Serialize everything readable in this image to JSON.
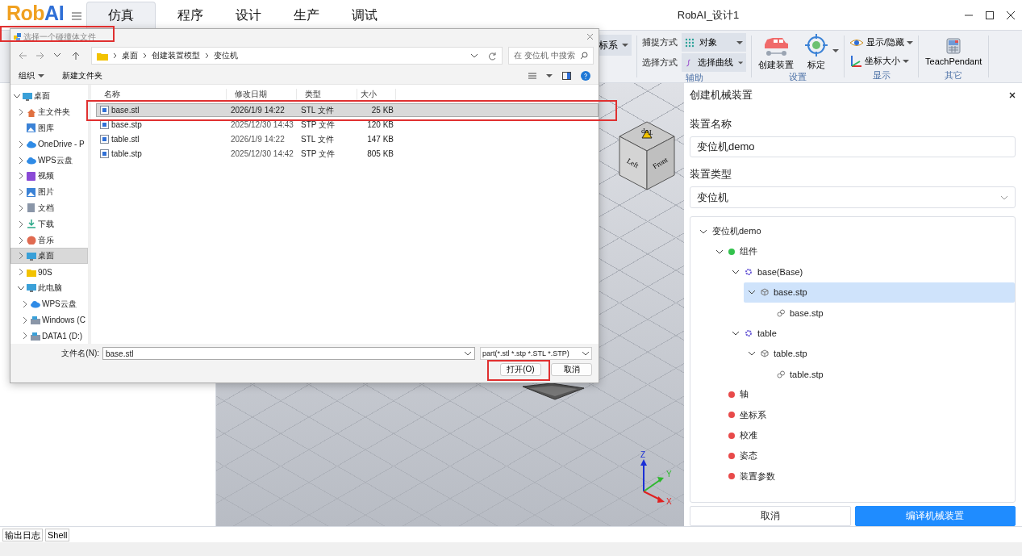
{
  "app": {
    "logo": [
      {
        "text": "Rob",
        "color": "#f0a020"
      },
      {
        "text": "AI",
        "color": "#2f6fd6"
      }
    ],
    "tabs": [
      {
        "label": "仿真",
        "selected": true
      },
      {
        "label": "程序",
        "selected": false
      },
      {
        "label": "设计",
        "selected": false
      },
      {
        "label": "生产",
        "selected": false
      },
      {
        "label": "调试",
        "selected": false
      }
    ],
    "window_title": "RobAI_设计1"
  },
  "ribbon": {
    "partial_control": {
      "label": "标系",
      "dropdown": true
    },
    "groups": [
      {
        "label": "辅助",
        "kind": "dropdowns",
        "items": [
          {
            "label": "捕捉方式",
            "value": "对象"
          },
          {
            "label": "选择方式",
            "value": "选择曲线"
          }
        ]
      },
      {
        "label": "设置",
        "kind": "large",
        "items": [
          {
            "label": "创建装置",
            "dropdown": false
          },
          {
            "label": "标定",
            "dropdown": true
          }
        ]
      },
      {
        "label": "显示",
        "kind": "small",
        "items": [
          {
            "label": "显示/隐藏",
            "dropdown": true
          },
          {
            "label": "坐标大小",
            "dropdown": true
          }
        ]
      },
      {
        "label": "其它",
        "kind": "large",
        "items": [
          {
            "label": "TeachPendant",
            "dropdown": false
          }
        ]
      }
    ]
  },
  "viewport": {
    "view_cube": [
      "Top",
      "Left",
      "Front"
    ],
    "axes": [
      "Z",
      "Y",
      "X"
    ]
  },
  "right_panel": {
    "title": "创建机械装置",
    "fields": [
      {
        "label": "装置名称",
        "kind": "text",
        "value": "变位机demo"
      },
      {
        "label": "装置类型",
        "kind": "select",
        "value": "变位机"
      }
    ],
    "tree": [
      {
        "label": "变位机demo",
        "expanded": true,
        "selected": false,
        "children": [
          {
            "label": "组件",
            "kind": "group",
            "color": "#33c24d",
            "expanded": true,
            "selected": false,
            "children": [
              {
                "label": "base(Base)",
                "kind": "assembly",
                "expanded": true,
                "selected": false,
                "children": [
                  {
                    "label": "base.stp",
                    "kind": "part",
                    "expanded": true,
                    "selected": true,
                    "children": [
                      {
                        "label": "base.stp",
                        "kind": "file",
                        "selected": false
                      }
                    ]
                  }
                ]
              },
              {
                "label": "table",
                "kind": "assembly",
                "expanded": true,
                "selected": false,
                "children": [
                  {
                    "label": "table.stp",
                    "kind": "part",
                    "expanded": true,
                    "selected": false,
                    "children": [
                      {
                        "label": "table.stp",
                        "kind": "file",
                        "selected": false
                      }
                    ]
                  }
                ]
              }
            ]
          },
          {
            "label": "轴",
            "kind": "group",
            "color": "#e84a4a",
            "selected": false
          },
          {
            "label": "坐标系",
            "kind": "group",
            "color": "#e84a4a",
            "selected": false
          },
          {
            "label": "校准",
            "kind": "group",
            "color": "#e84a4a",
            "selected": false
          },
          {
            "label": "姿态",
            "kind": "group",
            "color": "#e84a4a",
            "selected": false
          },
          {
            "label": "装置参数",
            "kind": "group",
            "color": "#e84a4a",
            "selected": false
          }
        ]
      }
    ],
    "buttons": [
      {
        "label": "取消",
        "kind": "secondary"
      },
      {
        "label": "编译机械装置",
        "kind": "primary"
      }
    ]
  },
  "bottom_tabs": [
    "输出日志",
    "Shell"
  ],
  "dialog": {
    "title": "选择一个碰撞体文件",
    "title_highlighted": true,
    "breadcrumb": [
      "桌面",
      "创建装置模型",
      "变位机"
    ],
    "search": {
      "placeholder": "在 变位机 中搜索"
    },
    "toolbar": [
      {
        "label": "组织",
        "dropdown": true
      },
      {
        "label": "新建文件夹",
        "dropdown": false
      }
    ],
    "nav": [
      {
        "label": "桌面",
        "expanded": true,
        "selected": false,
        "children": [
          {
            "label": "主文件夹",
            "expanded": false,
            "selected": false
          },
          {
            "label": "图库",
            "selected": false
          },
          {
            "label": "OneDrive - P",
            "expanded": false,
            "selected": false
          },
          {
            "label": "WPS云盘",
            "expanded": false,
            "selected": false
          },
          {
            "label": "视频",
            "expanded": false,
            "selected": false
          },
          {
            "label": "图片",
            "expanded": false,
            "selected": false
          },
          {
            "label": "文档",
            "expanded": false,
            "selected": false
          },
          {
            "label": "下载",
            "expanded": false,
            "selected": false
          },
          {
            "label": "音乐",
            "expanded": false,
            "selected": false
          },
          {
            "label": "桌面",
            "expanded": false,
            "selected": true
          },
          {
            "label": "90S",
            "expanded": false,
            "selected": false
          },
          {
            "label": "此电脑",
            "expanded": true,
            "selected": false,
            "children": [
              {
                "label": "WPS云盘",
                "expanded": false,
                "selected": false
              },
              {
                "label": "Windows (C",
                "expanded": false,
                "selected": false
              },
              {
                "label": "DATA1 (D:)",
                "expanded": false,
                "selected": false
              }
            ]
          }
        ]
      }
    ],
    "columns": [
      "名称",
      "修改日期",
      "类型",
      "大小"
    ],
    "files": [
      {
        "name": "base.stl",
        "modified": "2026/1/9 14:22",
        "type": "STL 文件",
        "size": "25 KB",
        "selected": true,
        "highlighted": true
      },
      {
        "name": "base.stp",
        "modified": "2025/12/30 14:43",
        "type": "STP 文件",
        "size": "120 KB",
        "selected": false,
        "highlighted": false
      },
      {
        "name": "table.stl",
        "modified": "2026/1/9 14:22",
        "type": "STL 文件",
        "size": "147 KB",
        "selected": false,
        "highlighted": false
      },
      {
        "name": "table.stp",
        "modified": "2025/12/30 14:42",
        "type": "STP 文件",
        "size": "805 KB",
        "selected": false,
        "highlighted": false
      }
    ],
    "file_name_label": "文件名(N):",
    "file_name": "base.stl",
    "file_type": "part(*.stl *.stp *.STL *.STP)",
    "buttons": [
      {
        "label": "打开(O)",
        "highlighted": true
      },
      {
        "label": "取消",
        "highlighted": false
      }
    ]
  }
}
